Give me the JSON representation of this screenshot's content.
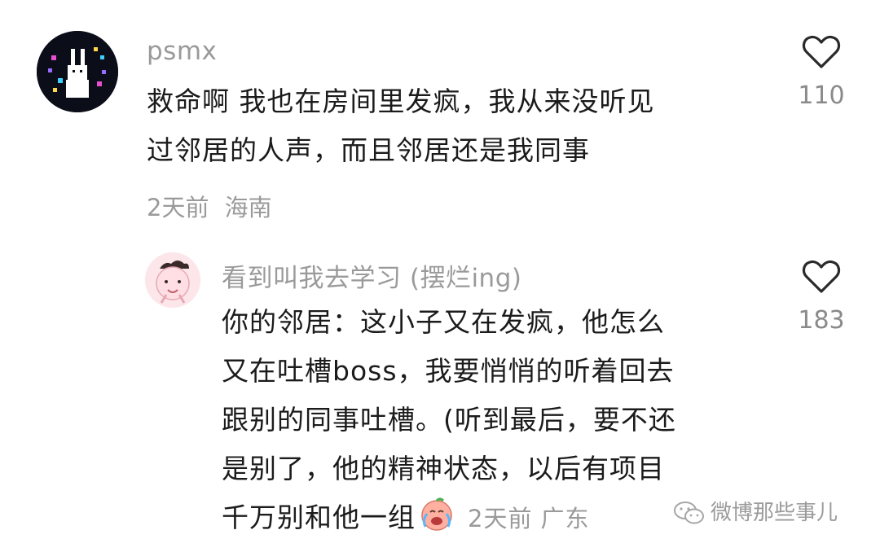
{
  "comment1": {
    "username": "psmx",
    "lines": [
      "救命啊 我也在房间里发疯，我从来没听见",
      "过邻居的人声，而且邻居还是我同事"
    ],
    "time": "2天前",
    "location": "海南",
    "like_count": "110"
  },
  "reply1": {
    "username": "看到叫我去学习 (摆烂ing)",
    "lines": [
      "你的邻居：这小子又在发疯，他怎么",
      "又在吐槽boss，我要悄悄的听着回去",
      "跟别的同事吐槽。(听到最后，要不还",
      "是别了，他的精神状态，以后有项目",
      "千万别和他一组"
    ],
    "emoji": "crying-face-emoji",
    "time": "2天前",
    "location": "广东",
    "like_count": "183"
  },
  "watermark": {
    "text": "微博那些事儿",
    "icon": "wechat-icon"
  },
  "colors": {
    "meta": "#9a9a9a",
    "text": "#1b1b1b"
  }
}
